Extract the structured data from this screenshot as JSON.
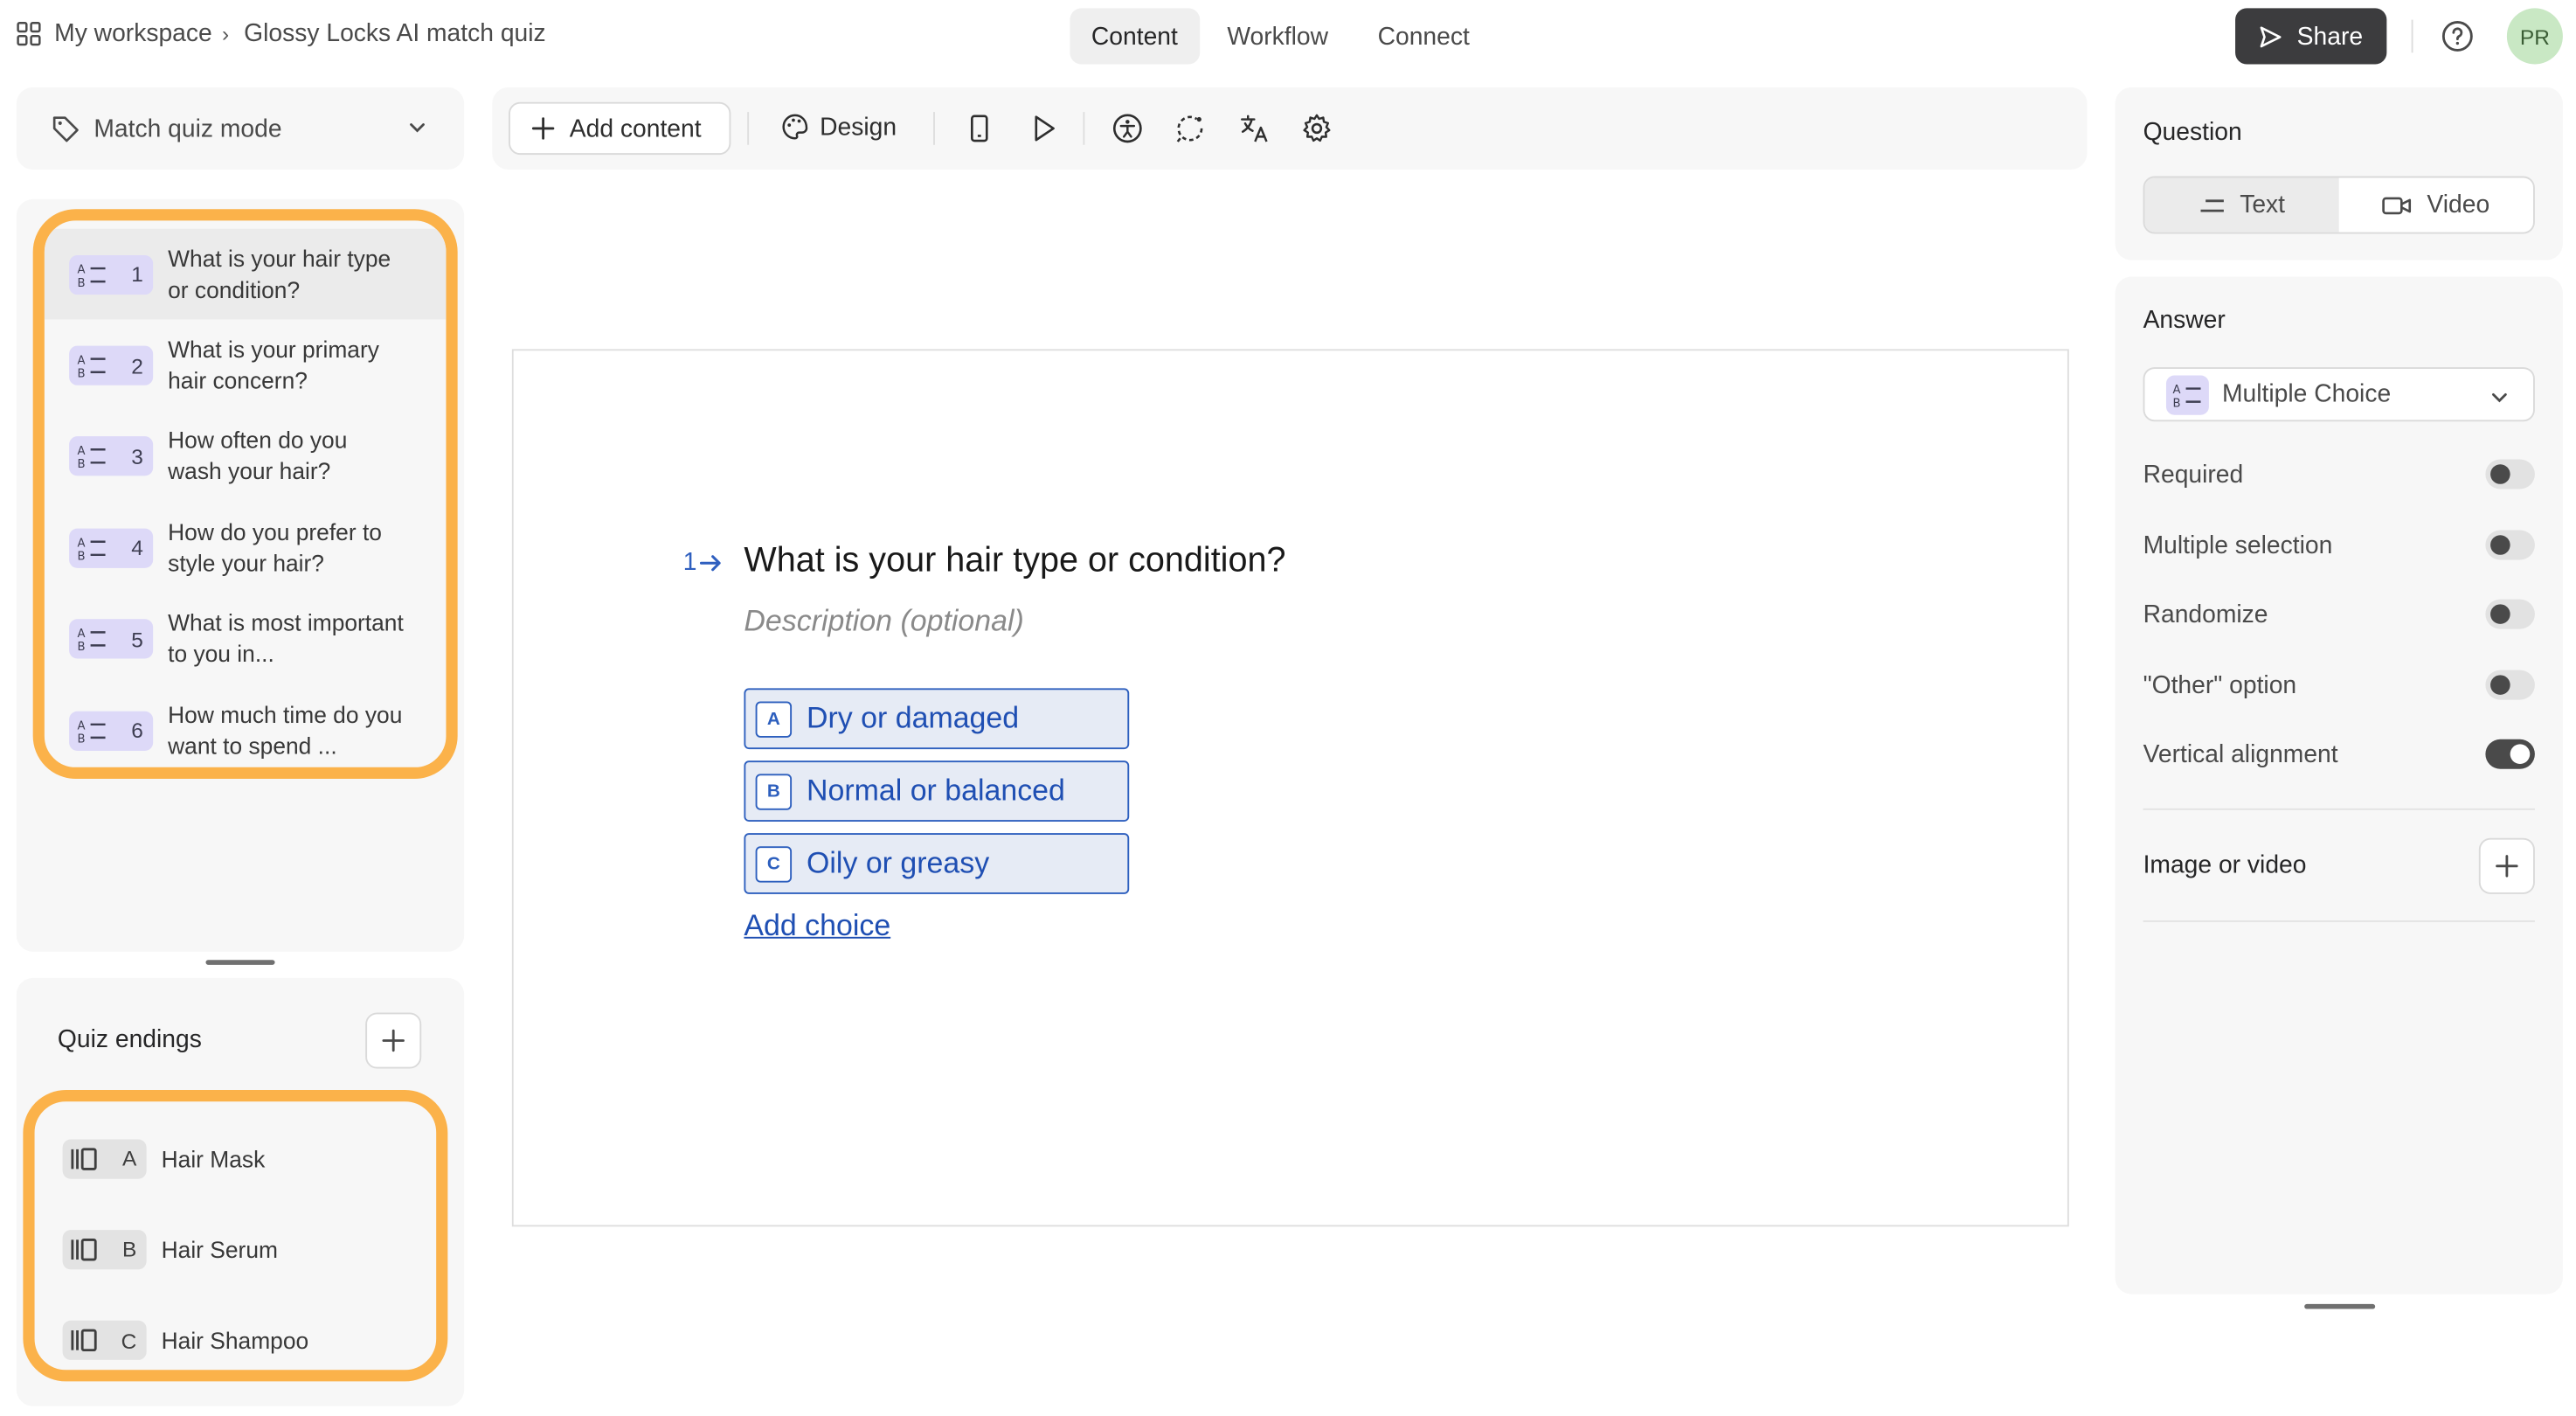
{
  "breadcrumb": {
    "workspace": "My workspace",
    "separator": "›",
    "form": "Glossy Locks AI match quiz"
  },
  "nav_tabs": [
    "Content",
    "Workflow",
    "Connect"
  ],
  "share_label": "Share",
  "avatar_initials": "PR",
  "mode_select": "Match quiz mode",
  "questions": [
    {
      "num": "1",
      "text": "What is your hair type or condition?"
    },
    {
      "num": "2",
      "text": "What is your primary hair concern?"
    },
    {
      "num": "3",
      "text": "How often do you wash your hair?"
    },
    {
      "num": "4",
      "text": "How do you prefer to style your hair?"
    },
    {
      "num": "5",
      "text": "What is most important to you in..."
    },
    {
      "num": "6",
      "text": "How much time do you want to spend ..."
    }
  ],
  "endings": {
    "title": "Quiz endings",
    "items": [
      {
        "key": "A",
        "text": "Hair Mask"
      },
      {
        "key": "B",
        "text": "Hair Serum"
      },
      {
        "key": "C",
        "text": "Hair Shampoo"
      }
    ]
  },
  "toolbar": {
    "add_content": "Add content",
    "design": "Design"
  },
  "canvas": {
    "question_number": "1",
    "question_title": "What is your hair type or condition?",
    "description_placeholder": "Description (optional)",
    "choices": [
      {
        "key": "A",
        "text": "Dry or damaged"
      },
      {
        "key": "B",
        "text": "Normal or balanced"
      },
      {
        "key": "C",
        "text": "Oily or greasy"
      }
    ],
    "add_choice": "Add choice"
  },
  "question_panel": {
    "title": "Question",
    "text_tab": "Text",
    "video_tab": "Video"
  },
  "answer_panel": {
    "title": "Answer",
    "type": "Multiple Choice",
    "toggles": [
      {
        "label": "Required",
        "on": false
      },
      {
        "label": "Multiple selection",
        "on": false
      },
      {
        "label": "Randomize",
        "on": false
      },
      {
        "label": "\"Other\" option",
        "on": false
      },
      {
        "label": "Vertical alignment",
        "on": true
      }
    ],
    "media_label": "Image or video"
  },
  "colors": {
    "highlight": "#fbb24a",
    "choice_blue": "#2d5fbe",
    "badge_purple": "#ddd9f8",
    "share_bg": "#3c3c3e"
  }
}
